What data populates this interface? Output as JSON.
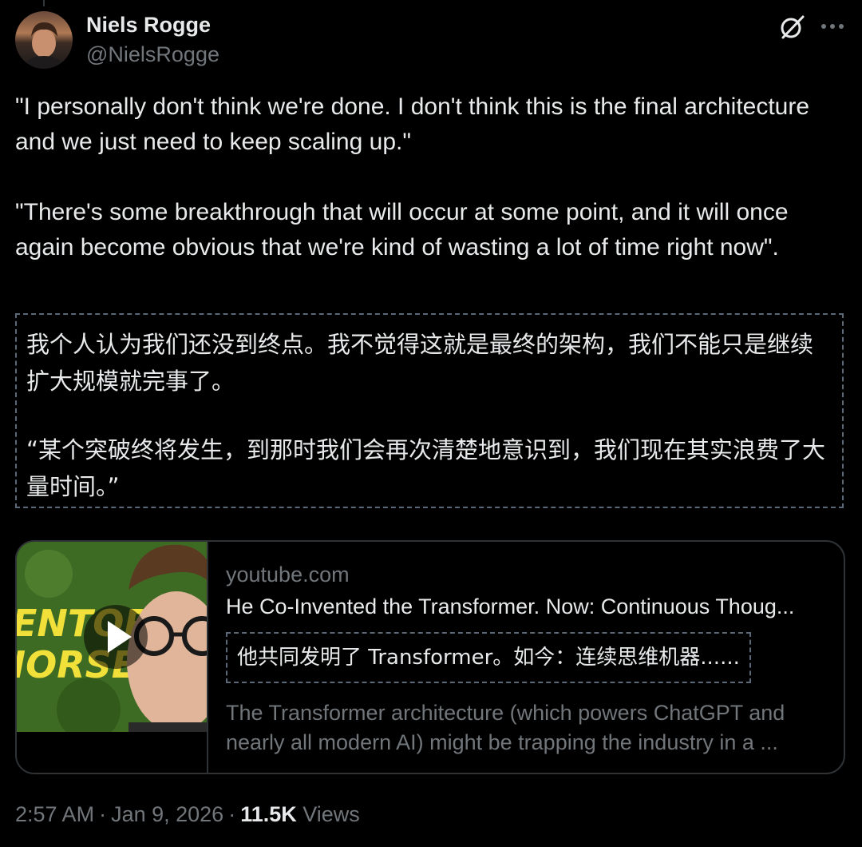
{
  "author": {
    "display_name": "Niels Rogge",
    "handle": "@NielsRogge"
  },
  "tweet": {
    "paragraphs": [
      "\"I personally don't think we're done. I don't think this is the final architecture and we just need to keep scaling up.\"",
      "\"There's some breakthrough that will occur at some point, and it will once again become obvious that we're kind of wasting a lot of time right now\"."
    ],
    "translation_paragraphs": [
      "我个人认为我们还没到终点。我不觉得这就是最终的架构，我们不能只是继续扩大规模就完事了。",
      "“某个突破终将发生，到那时我们会再次清楚地意识到，我们现在其实浪费了大量时间。”"
    ]
  },
  "link_card": {
    "domain": "youtube.com",
    "title": "He Co-Invented the Transformer. Now: Continuous Thoug...",
    "title_translation": "他共同发明了 Transformer。如今：连续思维机器......",
    "description_lines": [
      "The Transformer architecture (which powers ChatGPT and",
      "nearly all modern AI) might be trapping the industry in a ..."
    ],
    "thumbnail_text_line1": "ENTOR'S",
    "thumbnail_text_line2": "IORSE"
  },
  "meta": {
    "time": "2:57 AM",
    "separator": "·",
    "date": "Jan 9, 2026",
    "views_count": "11.5K",
    "views_label": "Views"
  },
  "icons": {
    "grok": "grok-icon",
    "more": "more-icon",
    "play": "play-icon"
  },
  "colors": {
    "background": "#000000",
    "text_primary": "#e7e9ea",
    "text_secondary": "#71767b",
    "border": "#2f3336",
    "translation_border": "#5a6877",
    "thumbnail_text": "#f2e03a"
  }
}
